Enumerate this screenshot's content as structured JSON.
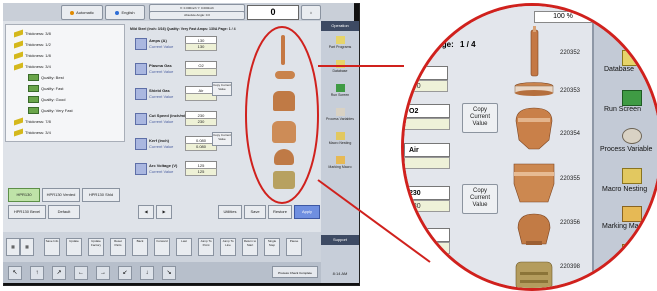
{
  "screen": {
    "topbar": {
      "automatic_label": "Automatic",
      "english_label": "English",
      "big_value": "0",
      "info_line1": "X: 0.000inch   Y: 0.000inch",
      "info_line2": "Absolute   Angle: 0.0",
      "info_line3": "Plasma Cutting, H",
      "info_line4": "Disabled   100 %"
    },
    "tree": [
      {
        "label": "Thickness: 3/8",
        "type": "thickness"
      },
      {
        "label": "Thickness: 1/2",
        "type": "thickness"
      },
      {
        "label": "Thickness: 1/8",
        "type": "thickness"
      },
      {
        "label": "Thickness: 3/4",
        "type": "thickness"
      },
      {
        "label": "Quality: Best",
        "type": "quality"
      },
      {
        "label": "Quality: Fast",
        "type": "quality"
      },
      {
        "label": "Quality: Good",
        "type": "quality"
      },
      {
        "label": "Quality: Very Fast",
        "type": "quality"
      },
      {
        "label": "Thickness: 7/8",
        "type": "thickness"
      },
      {
        "label": "Thickness: 3/4",
        "type": "thickness"
      }
    ],
    "list_header": "Mild Steel (inch: 3/16) Quality: Very Fast  Amps: 130A   Page: 1 / 4",
    "params": [
      {
        "label": "Amps (A)",
        "sub": "Current Value",
        "value": "130",
        "current": "130"
      },
      {
        "label": "Plasma Gas",
        "sub": "Current Value",
        "value": "O2",
        "current": ""
      },
      {
        "label": "Shield Gas",
        "sub": "Current Value",
        "value": "Air",
        "current": ""
      },
      {
        "label": "Cut Speed (inch/min)",
        "sub": "Current Value",
        "value": "230",
        "current": "230"
      },
      {
        "label": "Kerf (inch)",
        "sub": "Current Value",
        "value": "0.080",
        "current": "0.080"
      },
      {
        "label": "Arc Voltage (V)",
        "sub": "Current Value",
        "value": "125",
        "current": "125"
      }
    ],
    "copy_label": "Copy Current Value",
    "process_buttons": [
      "HPR130",
      "HPR130 Vented",
      "HPR130 Shld",
      "HPR130 Bevel",
      "Default"
    ],
    "action_buttons": [
      "Utilities",
      "Save",
      "Restore",
      "Apply"
    ],
    "soft_buttons": [
      "Save Info",
      "Update",
      "Update Factory",
      "Reset Parts",
      "Back",
      "Forward",
      "Last",
      "Jump To Point",
      "Jump To Line",
      "Return to Start",
      "Single Step",
      "Pause"
    ],
    "right_panel": {
      "header": "Operation",
      "items": [
        "Part Programs",
        "Database",
        "Run Screen",
        "Process Variables",
        "Macro Nesting",
        "Marking Macro"
      ],
      "footer": "Support",
      "time": "8:14 AM"
    },
    "status_footer": "Process Check Complete"
  },
  "zoom": {
    "header_fragment": "A",
    "page_label": "Page:",
    "page_value": "1 / 4",
    "percent": "100 %",
    "fields": [
      {
        "value": "30",
        "current": "200"
      },
      {
        "value": "O2",
        "current": ""
      },
      {
        "value": "Air",
        "current": ""
      },
      {
        "value": "230",
        "current": "230"
      },
      {
        "value": "0.095",
        "current": "0.095"
      }
    ],
    "copy_buttons": [
      {
        "line1": "Copy",
        "line2": "Current",
        "line3": "Value"
      },
      {
        "line1": "Copy",
        "line2": "Current",
        "line3": "Value"
      }
    ],
    "parts": [
      "220352",
      "220353",
      "220354",
      "220355",
      "220356",
      "220398"
    ],
    "right_items": [
      "Database",
      "Run Screen",
      "Process Variable",
      "Macro Nesting",
      "Marking Ma",
      "Pro"
    ],
    "colors": {
      "accent": "#d0211d",
      "copper": "#c9834c",
      "panel": "#c3cad6"
    }
  }
}
